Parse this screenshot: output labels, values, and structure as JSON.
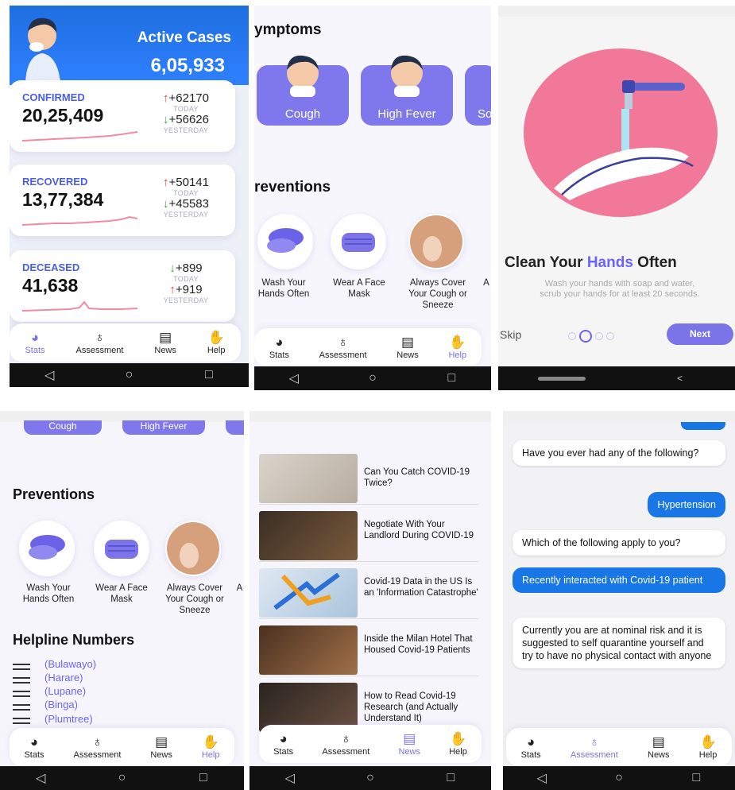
{
  "panel1": {
    "hero": {
      "title": "Active Cases",
      "value": "6,05,933"
    },
    "cards": [
      {
        "label": "CONFIRMED",
        "value": "20,25,409",
        "today": "+62170",
        "today_label": "TODAY",
        "yesterday": "+56626",
        "yesterday_label": "YESTERDAY"
      },
      {
        "label": "RECOVERED",
        "value": "13,77,384",
        "today": "+50141",
        "today_label": "TODAY",
        "yesterday": "+45583",
        "yesterday_label": "YESTERDAY"
      },
      {
        "label": "DECEASED",
        "value": "41,638",
        "today": "+899",
        "today_label": "TODAY",
        "yesterday": "+919",
        "yesterday_label": "YESTERDAY"
      }
    ],
    "nav": {
      "stats": "Stats",
      "assessment": "Assessment",
      "news": "News",
      "help": "Help"
    }
  },
  "panel2": {
    "symptoms_heading": "ymptoms",
    "symptoms": [
      "Cough",
      "High Fever",
      "So"
    ],
    "preventions_heading": "reventions",
    "preventions": [
      "Wash Your\nHands Often",
      "Wear A Face\nMask",
      "Always Cover\nYour Cough or\nSneeze",
      "A"
    ],
    "nav": {
      "stats": "Stats",
      "assessment": "Assessment",
      "news": "News",
      "help": "Help"
    }
  },
  "panel3": {
    "title_a": "Clean Your ",
    "title_b": "Hands",
    "title_c": " Often",
    "subtitle_1": "Wash your hands with soap and water,",
    "subtitle_2": "scrub your hands for at least 20 seconds.",
    "skip": "Skip",
    "next": "Next"
  },
  "panel4": {
    "chips": [
      "Cough",
      "High Fever"
    ],
    "preventions_heading": "Preventions",
    "preventions": [
      "Wash Your\nHands Often",
      "Wear A Face\nMask",
      "Always Cover\nYour Cough or\nSneeze",
      "A"
    ],
    "helpline_heading": "Helpline Numbers",
    "helplines": [
      "(Bulawayo)",
      "(Harare)",
      "(Lupane)",
      "(Binga)",
      "(Plumtree)"
    ],
    "nav": {
      "stats": "Stats",
      "assessment": "Assessment",
      "news": "News",
      "help": "Help"
    }
  },
  "panel5": {
    "news": [
      "Can You Catch COVID-19 Twice?",
      "Negotiate With Your Landlord During COVID-19",
      "Covid-19 Data in the US Is an 'Information Catastrophe'",
      "Inside the Milan Hotel That Housed Covid-19 Patients",
      "How to Read Covid-19 Research (and Actually Understand It)"
    ],
    "nav": {
      "stats": "Stats",
      "assessment": "Assessment",
      "news": "News",
      "help": "Help"
    }
  },
  "panel6": {
    "messages": [
      {
        "from": "bot",
        "text": "Have you ever had any of the following?"
      },
      {
        "from": "me",
        "text": "Hypertension"
      },
      {
        "from": "bot",
        "text": "Which of the following apply to you?"
      },
      {
        "from": "me",
        "text": "Recently interacted with Covid-19 patient"
      },
      {
        "from": "bot",
        "text": "Currently you are at nominal risk and it is suggested to self quarantine yourself and try to have no physical contact with anyone"
      }
    ],
    "nav": {
      "stats": "Stats",
      "assessment": "Assessment",
      "news": "News",
      "help": "Help"
    }
  },
  "colors": {
    "accent": "#6c63ff",
    "hero_blue": "#2f80ff",
    "chat_blue": "#1976e6",
    "up": "#e53935",
    "down": "#43a047"
  },
  "icons": {
    "stats": "pie-chart-icon",
    "assessment": "stethoscope-icon",
    "news": "newspaper-icon",
    "help": "handshake-icon"
  }
}
